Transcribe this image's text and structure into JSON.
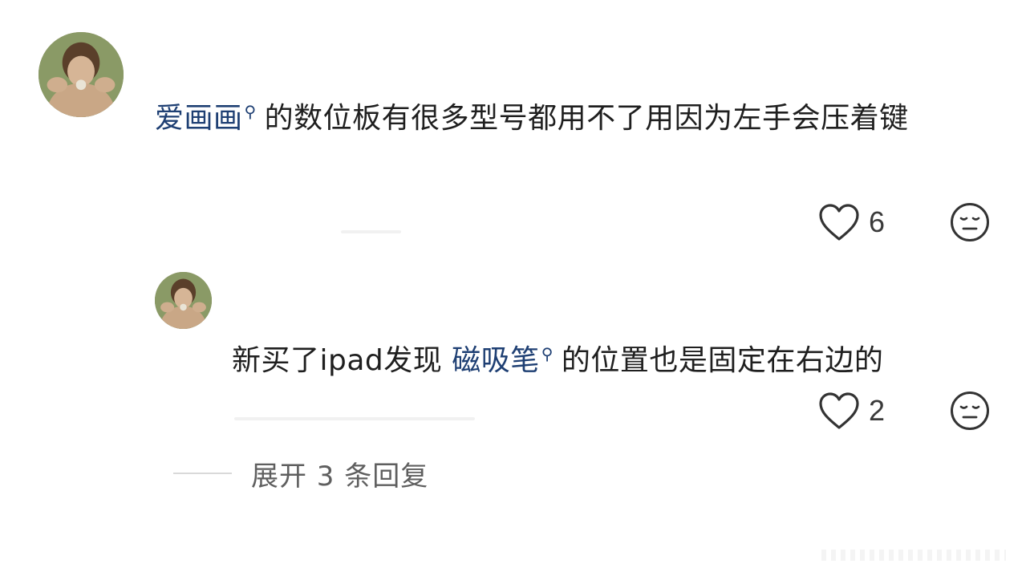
{
  "main_comment": {
    "topic": "爱画画",
    "text": "的数位板有很多型号都用不了用因为左手会压着键",
    "like_count": "6"
  },
  "reply": {
    "text_before": "新买了ipad发现",
    "topic": "磁吸笔",
    "text_after": "的位置也是固定在右边的",
    "like_count": "2"
  },
  "expand": {
    "label": "展开 3 条回复"
  },
  "icons": {
    "search": "search-icon",
    "like": "heart-icon",
    "reaction": "neutral-face-icon"
  },
  "colors": {
    "link": "#1e3f73",
    "text": "#1f1f1f",
    "muted": "#5f5f5f"
  }
}
